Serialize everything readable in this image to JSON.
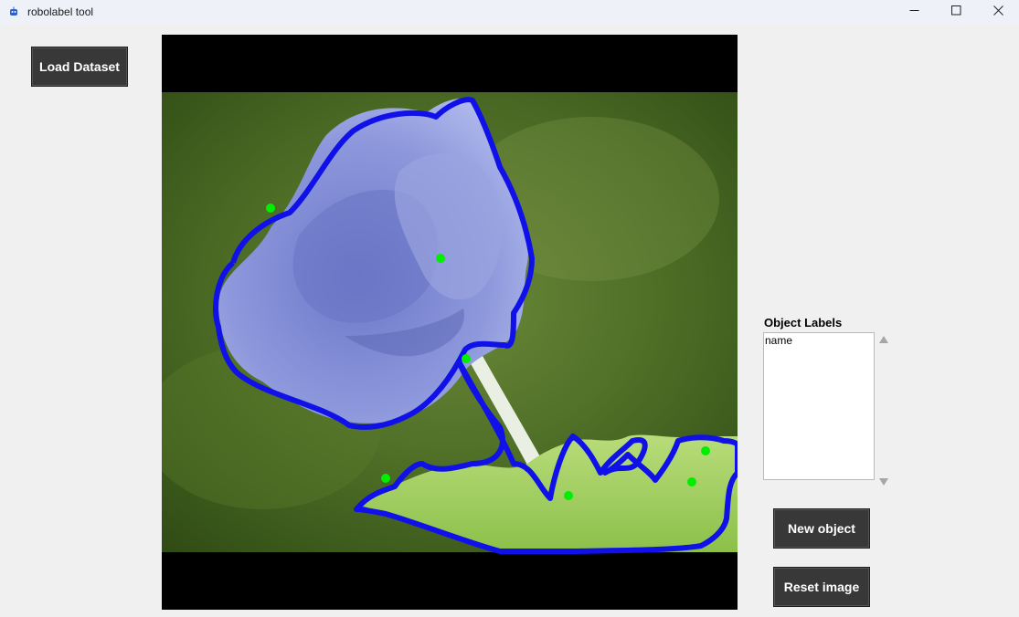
{
  "window": {
    "title": "robolabel tool",
    "app_icon": "robot-icon",
    "controls": [
      "minimize-icon",
      "maximize-icon",
      "close-icon"
    ]
  },
  "buttons": {
    "load_dataset": "Load Dataset",
    "new_object": "New object",
    "reset_image": "Reset image"
  },
  "labels_panel": {
    "title": "Object Labels",
    "items": [
      "name"
    ]
  },
  "colors": {
    "outline": "#1010e8",
    "keypoint": "#00ee00",
    "button_bg": "#383838"
  }
}
